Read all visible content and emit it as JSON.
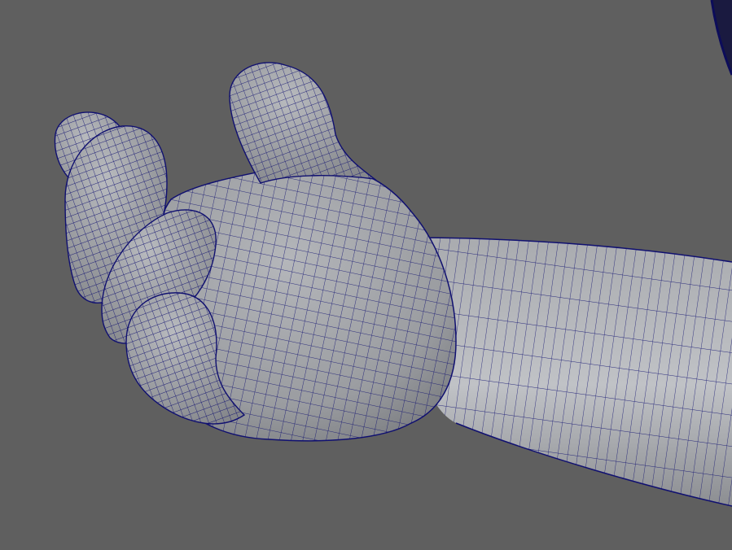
{
  "viewport": {
    "background_color": "#5f5f5f",
    "mesh_fill_color": "#9a9ca0",
    "mesh_wire_color": "#101070",
    "shadow_color": "#6e7076",
    "highlight_color": "#b6b8bc"
  },
  "scene": {
    "objects": [
      "hand-mesh",
      "thumb",
      "index-finger",
      "middle-finger",
      "ring-finger",
      "pinky-finger",
      "forearm-mesh",
      "background-object-edge"
    ]
  }
}
